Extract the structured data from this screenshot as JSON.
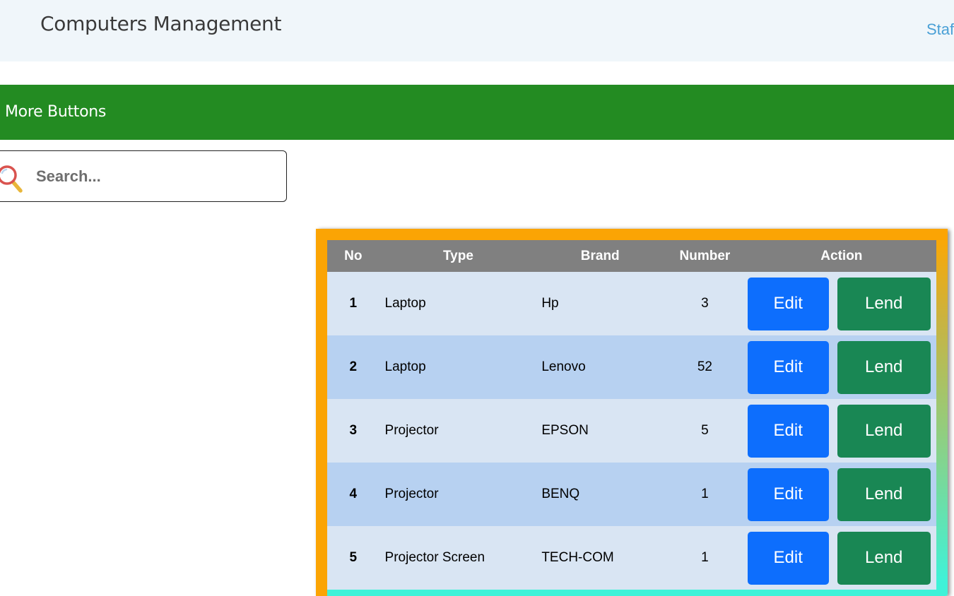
{
  "header": {
    "title": "Computers Management",
    "link_label": "Staf"
  },
  "toolbar": {
    "more_buttons_label": "More Buttons"
  },
  "search": {
    "placeholder": "Search...",
    "value": ""
  },
  "table": {
    "headers": {
      "no": "No",
      "type": "Type",
      "brand": "Brand",
      "number": "Number",
      "action": "Action"
    },
    "rows": [
      {
        "no": "1",
        "type": "Laptop",
        "brand": "Hp",
        "number": "3",
        "edit": "Edit",
        "lend": "Lend"
      },
      {
        "no": "2",
        "type": "Laptop",
        "brand": "Lenovo",
        "number": "52",
        "edit": "Edit",
        "lend": "Lend"
      },
      {
        "no": "3",
        "type": "Projector",
        "brand": "EPSON",
        "number": "5",
        "edit": "Edit",
        "lend": "Lend"
      },
      {
        "no": "4",
        "type": "Projector",
        "brand": "BENQ",
        "number": "1",
        "edit": "Edit",
        "lend": "Lend"
      },
      {
        "no": "5",
        "type": "Projector Screen",
        "brand": "TECH-COM",
        "number": "1",
        "edit": "Edit",
        "lend": "Lend"
      }
    ]
  },
  "colors": {
    "toolbar_green": "#238b22",
    "edit_blue": "#0d6efd",
    "lend_green": "#198754",
    "card_orange": "#fba404",
    "header_gray": "#808080",
    "row_light": "#d9e5f3",
    "row_dark": "#b7d1f1"
  },
  "icons": {
    "search": "search-icon"
  }
}
